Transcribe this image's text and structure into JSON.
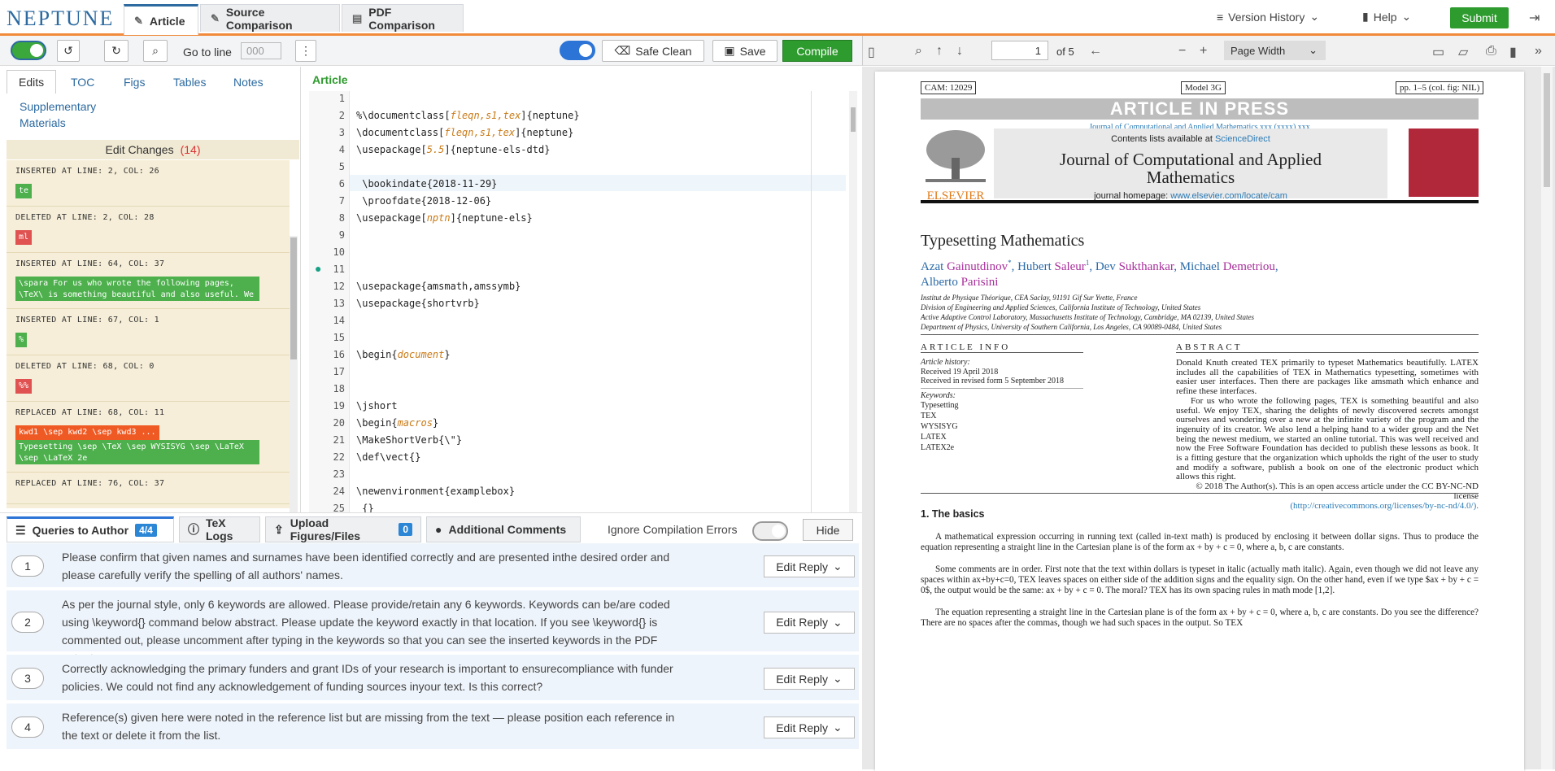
{
  "app": {
    "logo": "NEPTUNE",
    "tabs": [
      "Article",
      "Source Comparison",
      "PDF Comparison"
    ],
    "version_history": "Version History",
    "help": "Help",
    "submit": "Submit"
  },
  "editor_toolbar": {
    "goto_label": "Go to line",
    "goto_placeholder": "000",
    "safe_clean": "Safe Clean",
    "save": "Save",
    "compile": "Compile"
  },
  "left": {
    "tabs": [
      "Edits",
      "TOC",
      "Figs",
      "Tables",
      "Notes",
      "Supplementary",
      "Materials"
    ],
    "heading": "Edit Changes",
    "count": "(14)",
    "changes": [
      {
        "label": "INSERTED  AT LINE: 2, COL: 26",
        "chips": [
          {
            "t": "te",
            "c": "g"
          }
        ]
      },
      {
        "label": "DELETED  AT LINE: 2, COL: 28",
        "chips": [
          {
            "t": "ml",
            "c": "r"
          }
        ]
      },
      {
        "label": "INSERTED  AT LINE: 64, COL: 37",
        "chips": [
          {
            "t": "\\spara For us who wrote the following pages, \\TeX\\ is something beautiful and also useful. We enjoy",
            "c": "g"
          }
        ]
      },
      {
        "label": "INSERTED  AT LINE: 67, COL: 1",
        "chips": [
          {
            "t": "%",
            "c": "g"
          }
        ]
      },
      {
        "label": "DELETED  AT LINE: 68, COL: 0",
        "chips": [
          {
            "t": "%%",
            "c": "r"
          }
        ]
      },
      {
        "label": "REPLACED  AT LINE: 68, COL: 11",
        "chips": [
          {
            "t": "kwd1 \\sep kwd2 \\sep kwd3 ...",
            "c": "o"
          },
          {
            "t": "Typesetting \\sep \\TeX \\sep WYSISYG \\sep \\LaTeX \\sep \\LaTeX 2e",
            "c": "g"
          }
        ]
      },
      {
        "label": "REPLACED  AT LINE: 76, COL: 37",
        "chips": []
      }
    ]
  },
  "editor": {
    "title": "Article",
    "lines": [
      {
        "n": "1",
        "t": ""
      },
      {
        "n": "2",
        "t": "%\\documentclass[fleqn,s1,tex]{neptune}"
      },
      {
        "n": "3",
        "t": "\\documentclass[fleqn,s1,tex]{neptune}"
      },
      {
        "n": "4",
        "t": "\\usepackage[5.5]{neptune-els-dtd}"
      },
      {
        "n": "5",
        "t": ""
      },
      {
        "n": "6",
        "t": " \\bookindate{2018-11-29}"
      },
      {
        "n": "7",
        "t": " \\proofdate{2018-12-06}"
      },
      {
        "n": "8",
        "t": "\\usepackage[nptn]{neptune-els}"
      },
      {
        "n": "9",
        "t": ""
      },
      {
        "n": "10",
        "t": ""
      },
      {
        "n": "11",
        "t": ""
      },
      {
        "n": "12",
        "t": "\\usepackage{amsmath,amssymb}"
      },
      {
        "n": "13",
        "t": "\\usepackage{shortvrb}"
      },
      {
        "n": "14",
        "t": ""
      },
      {
        "n": "15",
        "t": ""
      },
      {
        "n": "16",
        "t": "\\begin{document}"
      },
      {
        "n": "17",
        "t": ""
      },
      {
        "n": "18",
        "t": ""
      },
      {
        "n": "19",
        "t": "\\jshort"
      },
      {
        "n": "20",
        "t": "\\begin{macros}"
      },
      {
        "n": "21",
        "t": "\\MakeShortVerb{\\\"}"
      },
      {
        "n": "22",
        "t": "\\def\\vect{}"
      },
      {
        "n": "23",
        "t": ""
      },
      {
        "n": "24",
        "t": "\\newenvironment{examplebox}"
      },
      {
        "n": "25",
        "t": " {}"
      }
    ]
  },
  "bottom": {
    "tabs": [
      "Queries to Author",
      "TeX Logs",
      "Upload Figures/Files",
      "Additional Comments"
    ],
    "queries_badge": "4/4",
    "upload_badge": "0",
    "ignore_label": "Ignore Compilation Errors",
    "hide": "Hide",
    "reply": "Edit Reply",
    "queries": [
      {
        "n": "1",
        "t": "Please confirm that given names and surnames have been identified correctly and are presented inthe desired order and please carefully verify the spelling of all authors' names."
      },
      {
        "n": "2",
        "t": "As per the journal style, only 6 keywords are allowed. Please provide/retain any 6 keywords. Keywords can be/are coded using \\keyword{} command below abstract. Please update the keyword exactly in that location. If you see \\keyword{} is commented out, please uncomment after typing in the keywords so that you can see the inserted keywords in the PDF output."
      },
      {
        "n": "3",
        "t": "Correctly acknowledging the primary funders and grant IDs of your research is important to ensurecompliance with funder policies. We could not find any acknowledgement of funding sources inyour text. Is this correct?"
      },
      {
        "n": "4",
        "t": "Reference(s) given here were noted in the reference list but are missing from the text — please position each reference in the text or delete it from the list."
      }
    ]
  },
  "pdf": {
    "page": "1",
    "of": "of 5",
    "zoom": "Page Width",
    "cam": "CAM: 12029",
    "model": "Model 3G",
    "pp": "pp. 1–5 (col. fig: NIL)",
    "aip": "ARTICLE IN PRESS",
    "jref": "Journal of Computational and Applied Mathematics xxx (xxxx) xxx",
    "contents": "Contents lists available at",
    "sd": "ScienceDirect",
    "journal": "Journal of Computational and Applied Mathematics",
    "homepage": "journal homepage:",
    "homeurl": "www.elsevier.com/locate/cam",
    "elsevier": "ELSEVIER",
    "title": "Typesetting Mathematics",
    "affils": [
      "Institut de Physique Théorique, CEA Saclay, 91191 Gif Sur Yvette, France",
      "Division of Engineering and Applied Sciences, California Institute of Technology, United States",
      "Active Adaptive Control Laboratory, Massachusetts Institute of Technology, Cambridge, MA 02139, United States",
      "Department of Physics, University of Southern California, Los Angeles, CA 90089-0484, United States"
    ],
    "info_head": "ARTICLE INFO",
    "abs_head": "ABSTRACT",
    "history": "Article history:",
    "received": "Received 19 April 2018",
    "revised": "Received in revised form 5 September 2018",
    "keywords_label": "Keywords:",
    "keywords": [
      "Typesetting",
      "TEX",
      "WYSISYG",
      "LATEX",
      "LATEX2e"
    ],
    "abstract1": "Donald Knuth created TEX primarily to typeset Mathematics beautifully. LATEX includes all the capabilities of TEX in Mathematics typesetting, sometimes with easier user interfaces. Then there are packages like amsmath which enhance and refine these interfaces.",
    "abstract2": "For us who wrote the following pages, TEX is something beautiful and also useful. We enjoy TEX, sharing the delights of newly discovered secrets amongst ourselves and wondering over a new at the infinite variety of the program and the ingenuity of its creator. We also lend a helping hand to a wider group and the Net being the newest medium, we started an online tutorial. This was well received and now the Free Software Foundation has decided to publish these lessons as book. It is a fitting gesture that the organization which upholds the right of the user to study and modify a software, publish a book on one of the electronic product which allows this right.",
    "copyright": "© 2018 The Author(s). This is an open access article under the CC BY-NC-ND license",
    "license": "(http://creativecommons.org/licenses/by-nc-nd/4.0/).",
    "section": "1.  The basics",
    "p1": "A mathematical expression occurring in running text (called in-text math) is produced by enclosing it between dollar signs. Thus to produce the equation representing a straight line in the Cartesian plane is of the form ax + by + c = 0, where a, b, c are constants.",
    "p2": "Some comments are in order. First note that the text within dollars is typeset in italic (actually math italic). Again, even though we did not leave any spaces within ax+by+c=0, TEX leaves spaces on either side of the addition signs and the equality sign. On the other hand, even if we type $ax + by + c = 0$, the output would be the same: ax + by + c = 0. The moral? TEX has its own spacing rules in math mode [1,2].",
    "p3": "The equation representing a straight line in the Cartesian plane is of the form ax + by + c = 0, where a, b, c are constants. Do you see the difference? There are no spaces after the commas, though we had such spaces in the output. So TEX"
  }
}
